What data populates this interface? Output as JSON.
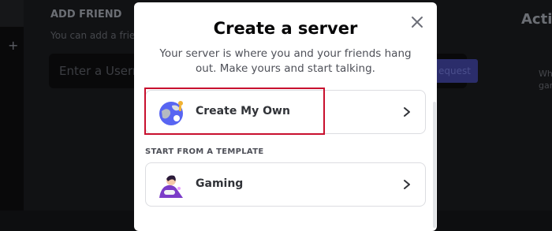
{
  "background": {
    "heading": "ADD FRIEND",
    "subtext": "You can add a friend",
    "input_placeholder": "Enter a Userna",
    "button_label": "equest",
    "right_title": "Activ",
    "right_sub_1": "Wh",
    "right_sub_2": "gan"
  },
  "modal": {
    "title": "Create a server",
    "subtitle": "Your server is where you and your friends hang out. Make yours and start talking.",
    "options": [
      {
        "label": "Create My Own",
        "icon": "globe-icon"
      },
      {
        "label": "Gaming",
        "icon": "gaming-controller-icon"
      }
    ],
    "section_label": "START FROM A TEMPLATE",
    "close_icon": "close-icon"
  },
  "colors": {
    "highlight_border": "#c8102e",
    "title": "#060607",
    "body_text": "#4e5058",
    "option_border": "#dcdde1",
    "gaming_icon": "#7b3cc8"
  }
}
